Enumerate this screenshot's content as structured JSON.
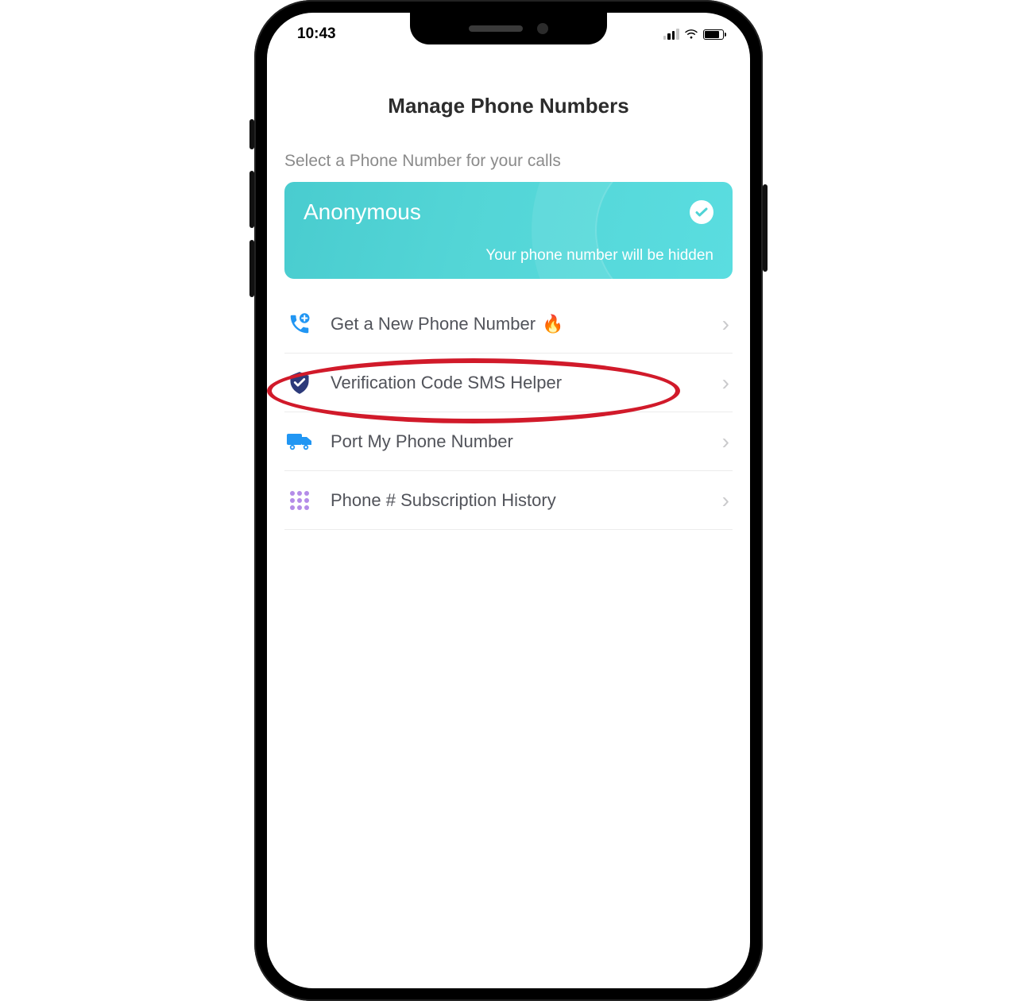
{
  "status": {
    "time": "10:43"
  },
  "header": {
    "title": "Manage Phone Numbers"
  },
  "hint": "Select a Phone Number for your calls",
  "card": {
    "title": "Anonymous",
    "subtitle": "Your phone number will be hidden",
    "selected": true
  },
  "menu": {
    "items": [
      {
        "id": "get-number",
        "label": "Get a New Phone Number",
        "emoji": "🔥",
        "icon": "phone-plus-icon"
      },
      {
        "id": "sms-helper",
        "label": "Verification Code SMS Helper",
        "icon": "shield-check-icon"
      },
      {
        "id": "port-number",
        "label": "Port My Phone Number",
        "icon": "truck-icon"
      },
      {
        "id": "sub-history",
        "label": "Phone # Subscription History",
        "icon": "keypad-icon"
      }
    ]
  },
  "colors": {
    "accent_teal": "#4fd3d5",
    "highlight_red": "#d11a2a",
    "icon_blue": "#2196f3",
    "icon_navy": "#2c3a7a",
    "icon_purple": "#9b6fda"
  }
}
